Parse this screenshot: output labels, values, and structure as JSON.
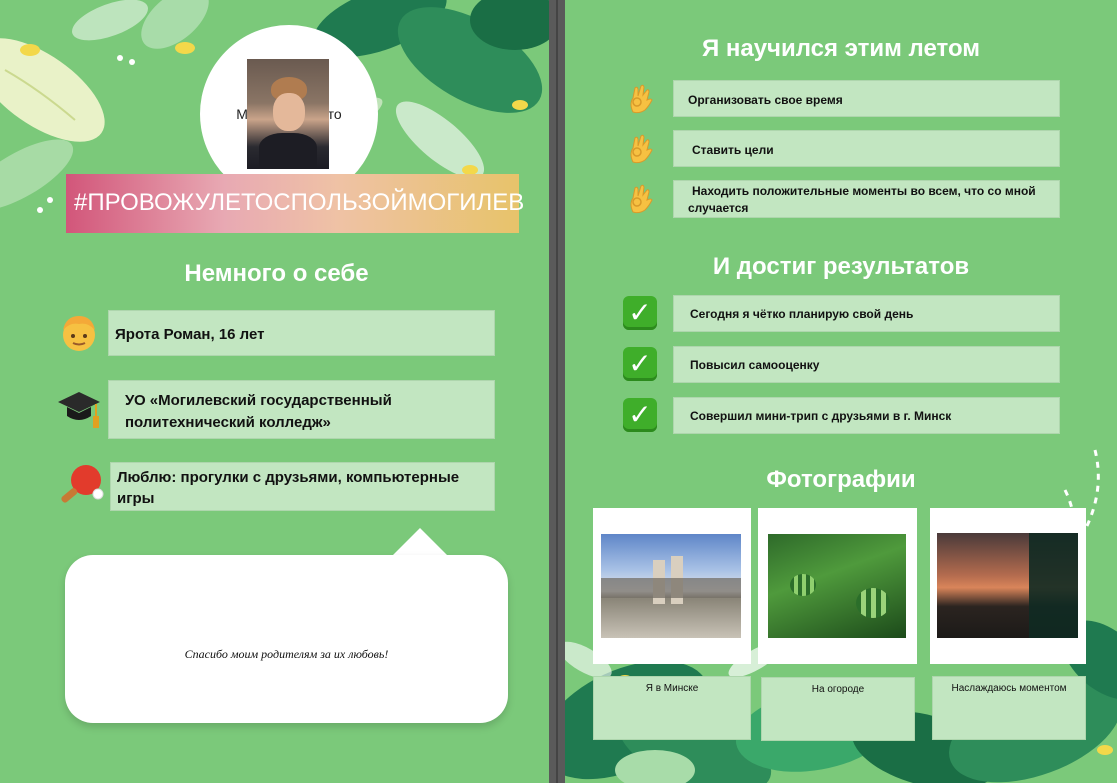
{
  "left": {
    "avatar_placeholder": "Место для фото",
    "hashtag": "#ПРОВОЖУЛЕТОСПОЛЬЗОЙМОГИЛЕВ",
    "about_heading": "Немного о себе",
    "about_items": [
      {
        "icon": "boy-face-icon",
        "text": "Ярота Роман, 16 лет"
      },
      {
        "icon": "graduation-cap-icon",
        "text": "УО «Могилевский государственный политехнический колледж»"
      },
      {
        "icon": "ping-pong-icon",
        "text": "Люблю: прогулки с друзьями, компьютерные игры"
      }
    ],
    "bubble_text": "Спасибо моим родителям за их любовь!"
  },
  "right": {
    "learned_heading": "Я научился этим летом",
    "learned_items": [
      {
        "icon": "ok-hand-icon",
        "text": "Организовать свое время"
      },
      {
        "icon": "ok-hand-icon",
        "text": "Ставить цели"
      },
      {
        "icon": "ok-hand-icon",
        "text": "Находить положительные моменты во всем, что со мной случается"
      }
    ],
    "results_heading": "И достиг результатов",
    "results_items": [
      {
        "icon": "check-mark-icon",
        "text": "Сегодня я чётко планирую свой день"
      },
      {
        "icon": "check-mark-icon",
        "text": "Повысил самооценку"
      },
      {
        "icon": "check-mark-icon",
        "text": "Совершил мини-трип с друзьями в г. Минск"
      }
    ],
    "photos_heading": "Фотографии",
    "photos": [
      {
        "caption": "Я в Минске"
      },
      {
        "caption": "На огороде"
      },
      {
        "caption": "Наслаждаюсь моментом"
      }
    ]
  },
  "colors": {
    "background": "#7bc97a",
    "box": "#c2e6c1",
    "leaf_dark": "#1f7a50",
    "leaf_mid": "#3aa86a",
    "yellow": "#f3d84a"
  }
}
